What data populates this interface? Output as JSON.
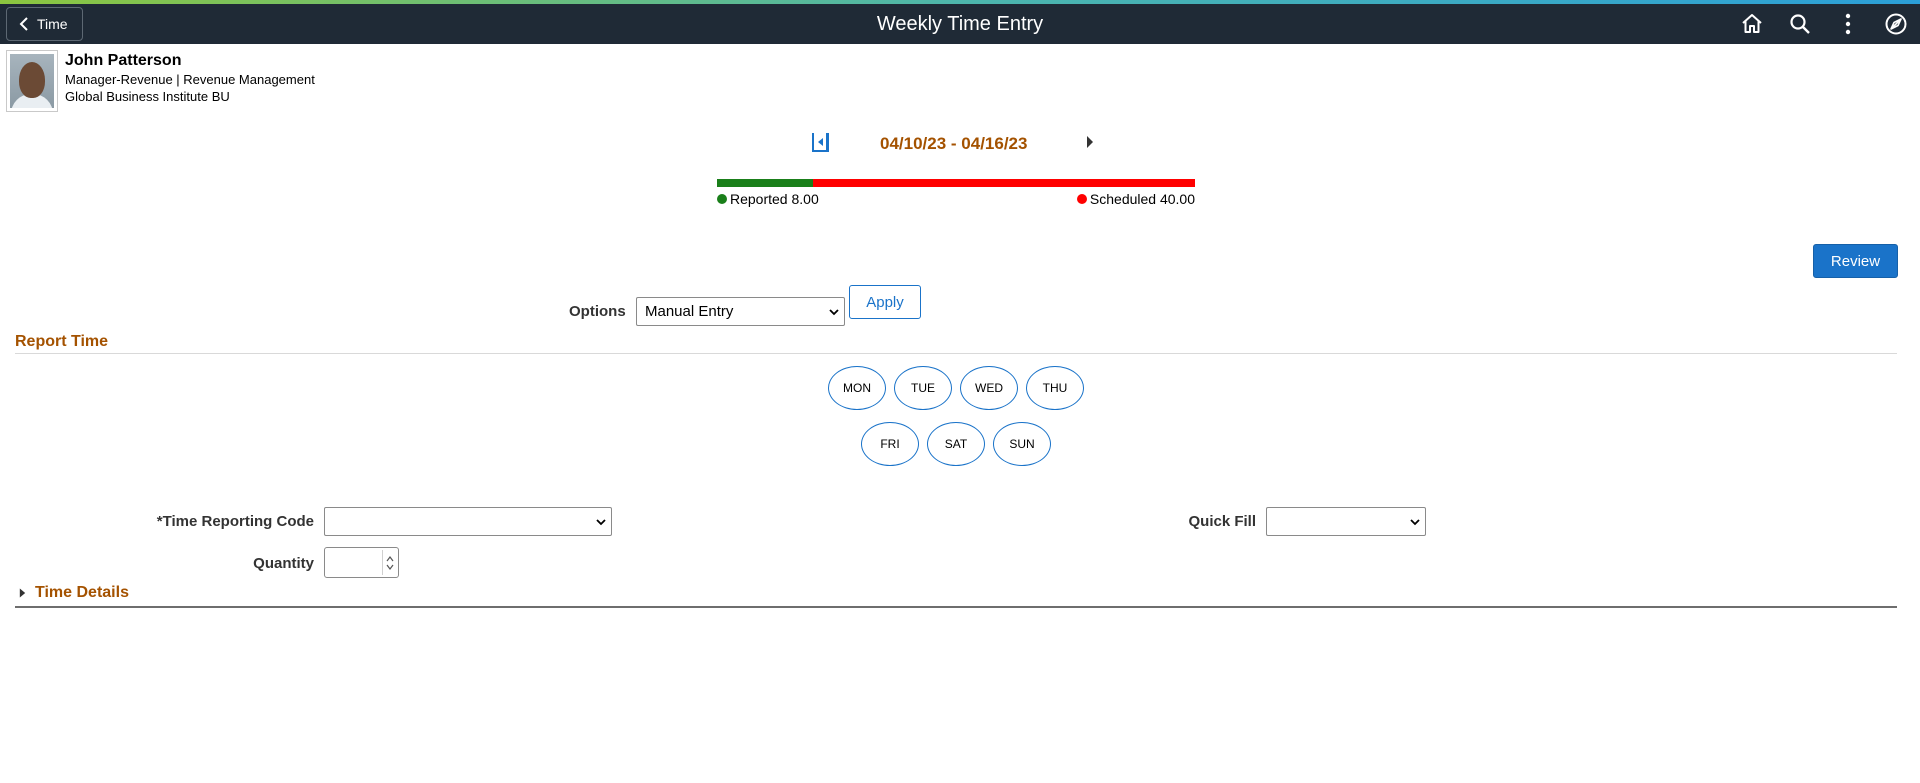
{
  "header": {
    "back_label": "Time",
    "title": "Weekly Time Entry",
    "icons": [
      "home-icon",
      "search-icon",
      "more-vertical-icon",
      "navbar-compass-icon"
    ]
  },
  "profile": {
    "name": "John Patterson",
    "line1": "Manager-Revenue | Revenue Management",
    "line2": "Global Business Institute BU"
  },
  "period": {
    "date_range": "04/10/23 - 04/16/23"
  },
  "hours_bar": {
    "reported_label": "Reported 8.00",
    "scheduled_label": "Scheduled 40.00",
    "reported_fraction": 0.2,
    "reported_color": "#1a7f1a",
    "scheduled_color": "#ff0000"
  },
  "actions": {
    "review_label": "Review",
    "apply_label": "Apply"
  },
  "options": {
    "label": "Options",
    "selected": "Manual Entry"
  },
  "report_time": {
    "title": "Report Time",
    "days": [
      "MON",
      "TUE",
      "WED",
      "THU",
      "FRI",
      "SAT",
      "SUN"
    ]
  },
  "fields": {
    "trc_label": "*Time Reporting Code",
    "trc_value": "",
    "quick_fill_label": "Quick Fill",
    "quick_fill_value": "",
    "quantity_label": "Quantity",
    "quantity_value": ""
  },
  "time_details": {
    "title": "Time Details"
  },
  "colors": {
    "header_bg": "#1f2a36",
    "accent": "#a45200",
    "primary": "#1a73c9"
  }
}
